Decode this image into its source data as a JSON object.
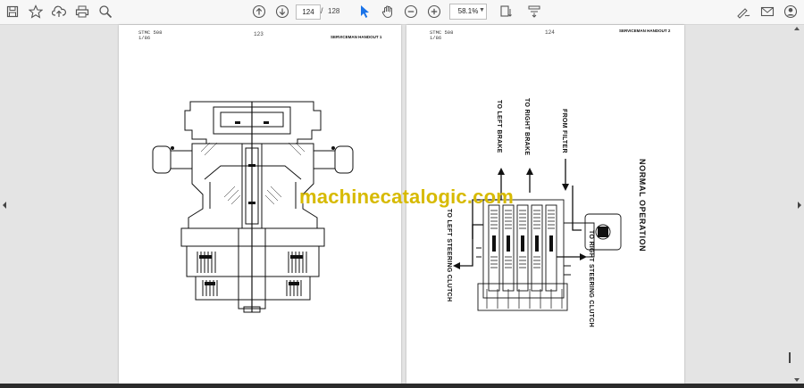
{
  "toolbar": {
    "page_current": "124",
    "page_separator": "/",
    "page_total": "128",
    "zoom": "58.1%",
    "icons": [
      "save-icon",
      "bookmark-star-icon",
      "upload-icon",
      "print-icon",
      "zoom-search-icon",
      "page-up-icon",
      "page-down-icon",
      "select-cursor-icon",
      "hand-icon",
      "zoom-out-icon",
      "zoom-in-icon",
      "fit-page-icon",
      "annotate-icon",
      "sign-icon",
      "email-icon",
      "account-icon"
    ]
  },
  "document": {
    "left_page": {
      "header_doc": "STMC 508",
      "header_date": "1/86",
      "page_number": "123",
      "header_title": "SERVICEMAN HANDOUT 1"
    },
    "right_page": {
      "header_doc": "STMC 508",
      "header_date": "1/86",
      "page_number": "124",
      "header_title": "SERVICEMAN HANDOUT 2",
      "labels": {
        "left_brake": "TO LEFT BRAKE",
        "right_brake": "TO RIGHT BRAKE",
        "from_filter": "FROM FILTER",
        "normal_operation": "NORMAL OPERATION",
        "left_steering": "TO LEFT STEERING CLUTCH",
        "right_steering": "TO RIGHT STEERING CLUTCH"
      }
    },
    "watermark": "machinecatalogic.com"
  }
}
